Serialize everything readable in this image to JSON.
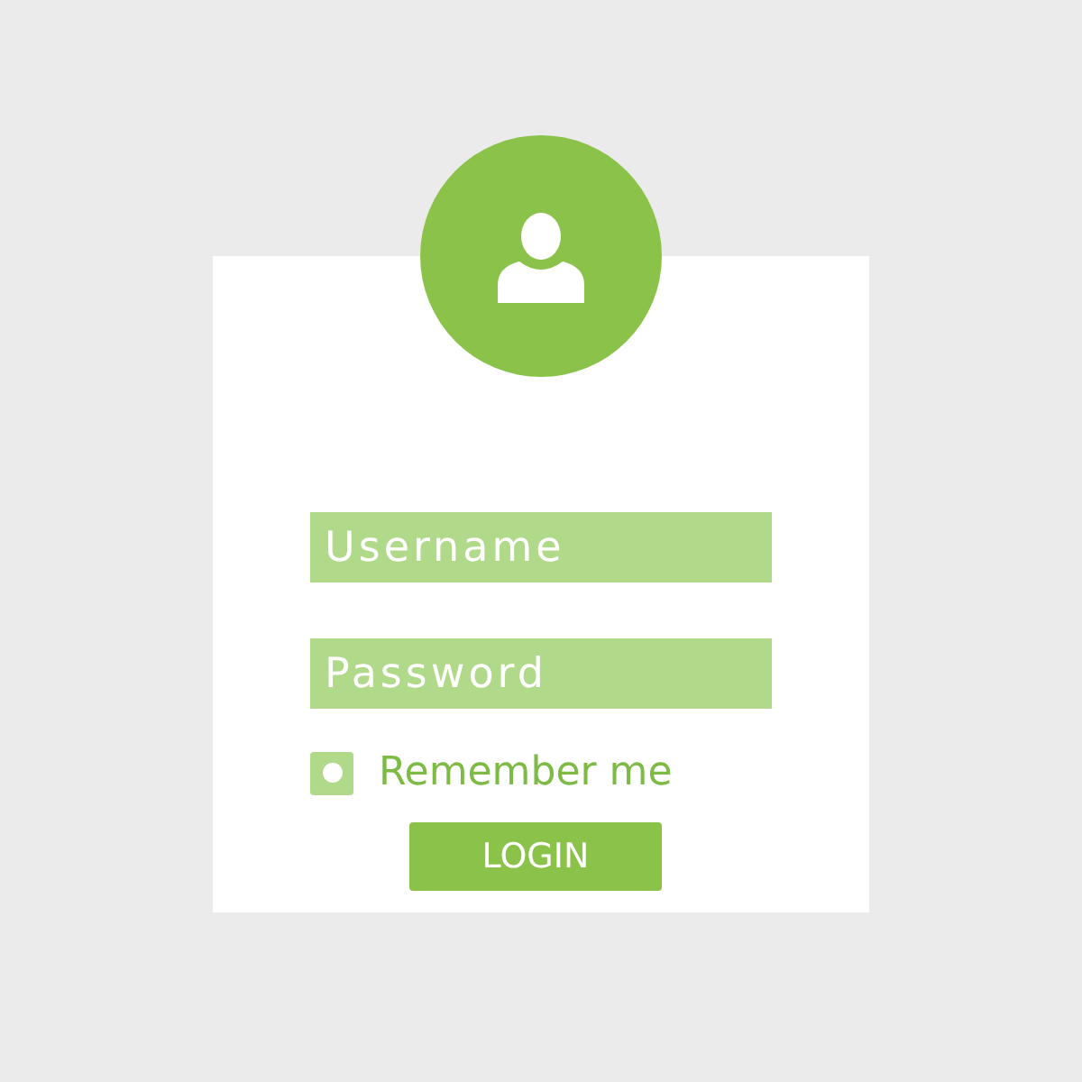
{
  "login_form": {
    "username": {
      "placeholder": "Username"
    },
    "password": {
      "placeholder": "Password"
    },
    "remember": {
      "label": "Remember me",
      "checked": true
    },
    "button": "LOGIN"
  }
}
